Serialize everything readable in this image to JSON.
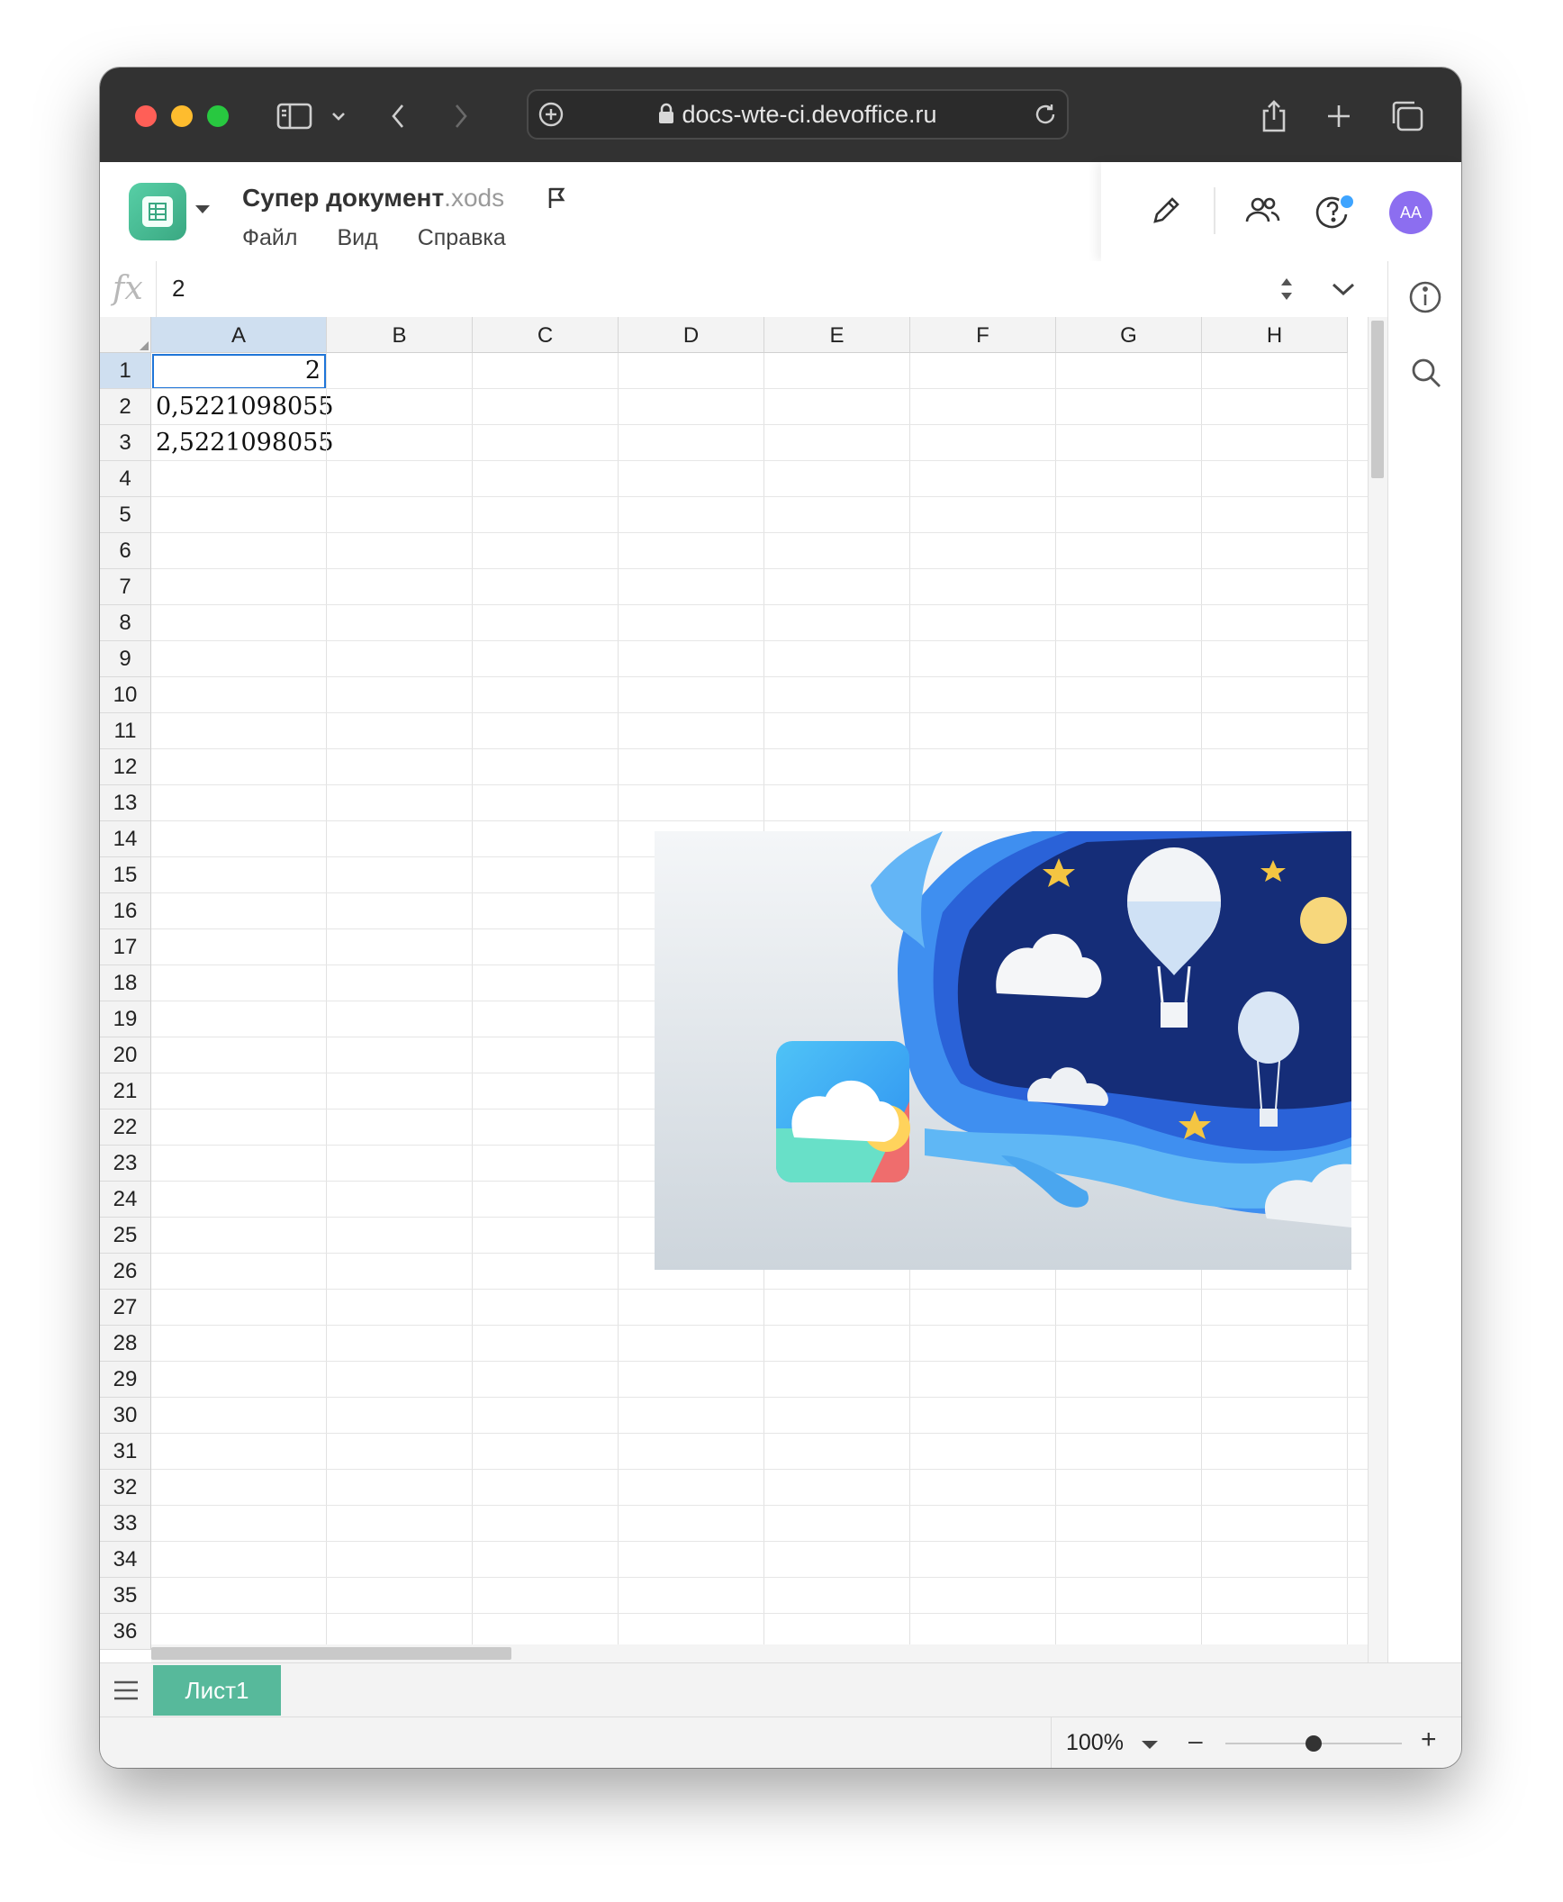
{
  "browser": {
    "url": "docs-wte-ci.devoffice.ru"
  },
  "app": {
    "doc_title": "Супер документ",
    "doc_ext": ".xods",
    "menu": [
      "Файл",
      "Вид",
      "Справка"
    ],
    "avatar_initials": "AA"
  },
  "formula_bar": {
    "fx_label": "fx",
    "value": "2"
  },
  "sheet": {
    "columns": [
      "A",
      "B",
      "C",
      "D",
      "E",
      "F",
      "G",
      "H"
    ],
    "selected_column": "A",
    "selected_row": 1,
    "visible_rows": [
      1,
      2,
      3,
      4,
      5,
      6,
      7,
      8,
      9,
      10,
      11,
      12,
      13,
      14,
      15,
      16,
      17,
      18,
      19,
      20,
      21,
      22,
      23,
      24,
      25,
      26,
      27,
      28,
      29,
      30,
      31,
      32,
      33,
      34,
      35,
      36
    ],
    "cells": {
      "A1": "2",
      "A2": "0,5221098055",
      "A3": "2,5221098055"
    }
  },
  "sheet_tabs": [
    "Лист1"
  ],
  "status": {
    "zoom": "100%",
    "zoom_minus": "–",
    "zoom_plus": "+",
    "zoom_level": 0.5
  }
}
